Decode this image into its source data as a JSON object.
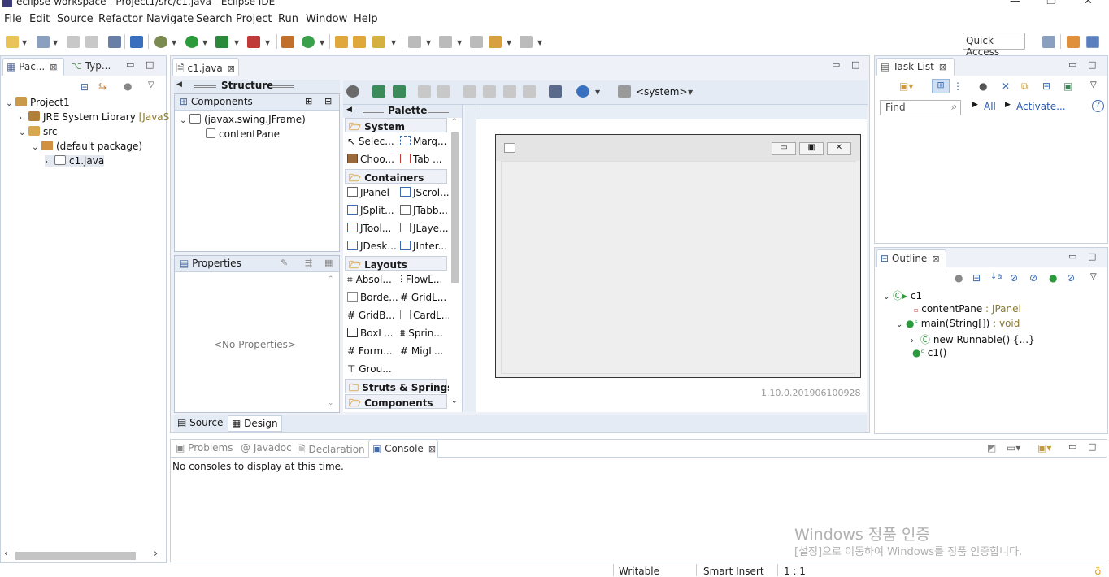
{
  "window": {
    "title": "eclipse-workspace - Project1/src/c1.java - Eclipse IDE"
  },
  "menu": [
    "File",
    "Edit",
    "Source",
    "Refactor",
    "Navigate",
    "Search",
    "Project",
    "Run",
    "Window",
    "Help"
  ],
  "toolbar": {
    "quick_access": "Quick Access"
  },
  "package_explorer": {
    "tabs": [
      {
        "label": "Pac..."
      },
      {
        "label": "Typ..."
      }
    ],
    "tree": [
      {
        "label": "Project1",
        "extra": ""
      },
      {
        "label": "JRE System Library",
        "extra": "[JavaSE"
      },
      {
        "label": "src",
        "extra": ""
      },
      {
        "label": "(default package)",
        "extra": ""
      },
      {
        "label": "c1.java",
        "extra": ""
      }
    ]
  },
  "editor": {
    "tab": "c1.java",
    "structure": {
      "title": "Structure",
      "components_title": "Components",
      "tree": [
        "(javax.swing.JFrame)",
        "contentPane"
      ]
    },
    "properties": {
      "title": "Properties",
      "empty": "<No Properties>"
    },
    "toolbar": {
      "system_label": "<system>"
    },
    "palette": {
      "title": "Palette",
      "categories": {
        "system": "System",
        "containers": "Containers",
        "layouts": "Layouts",
        "struts": "Struts & Springs",
        "components": "Components"
      },
      "items": {
        "selection": "Selec...",
        "marquee": "Marq...",
        "choose": "Choo...",
        "tab_order": "Tab ...",
        "jpanel": "JPanel",
        "jscroll": "JScrol...",
        "jsplit": "JSplit...",
        "jtabb": "JTabb...",
        "jtool": "JTool...",
        "jlaye": "JLaye...",
        "jdesk": "JDesk...",
        "jinter": "JInter...",
        "absol": "Absol...",
        "flowl": "FlowL...",
        "borde": "Borde...",
        "gridl": "GridL...",
        "gridb": "GridB...",
        "cardl": "CardL...",
        "boxl": "BoxL...",
        "sprin": "Sprin...",
        "form": "Form...",
        "migl": "MigL...",
        "grou": "Grou..."
      }
    },
    "version": "1.10.0.201906100928",
    "bottom_tabs": [
      "Source",
      "Design"
    ]
  },
  "task_list": {
    "title": "Task List",
    "find_placeholder": "Find",
    "all": "All",
    "activate": "Activate..."
  },
  "outline": {
    "title": "Outline",
    "tree": {
      "class": "c1",
      "field_name": "contentPane",
      "field_type": " : JPanel",
      "method_name": "main(String[])",
      "method_type": " : void",
      "anon": "new Runnable() {...}",
      "ctor": "c1()"
    }
  },
  "console": {
    "tabs": [
      "Problems",
      "Javadoc",
      "Declaration",
      "Console"
    ],
    "message": "No consoles to display at this time."
  },
  "status": {
    "writable": "Writable",
    "insert": "Smart Insert",
    "position": "1 : 1"
  },
  "watermark": {
    "line1": "Windows 정품 인증",
    "line2": "[설정]으로 이동하여 Windows를 정품 인증합니다."
  }
}
